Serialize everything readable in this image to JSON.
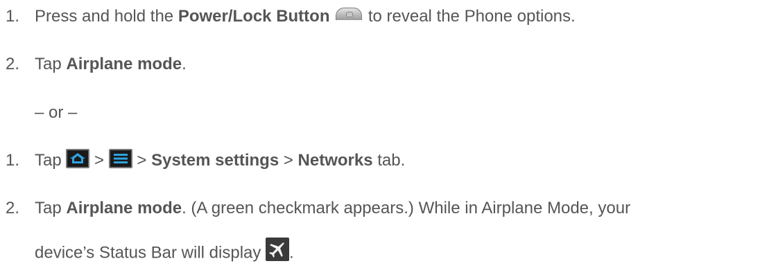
{
  "steps_a": [
    {
      "number": "1.",
      "pre": "Press and hold the ",
      "bold": "Power/Lock Button",
      "post": " to reveal the Phone options."
    },
    {
      "number": "2.",
      "pre": "Tap ",
      "bold": "Airplane mode",
      "post": "."
    }
  ],
  "separator": "– or –",
  "steps_b": [
    {
      "number": "1.",
      "tap": "Tap ",
      "sep1": " > ",
      "sep2": " > ",
      "bold1": "System settings",
      "sep3": " > ",
      "bold2": "Networks",
      "post": " tab."
    },
    {
      "number": "2.",
      "pre": "Tap ",
      "bold": "Airplane mode",
      "post": ". (A green checkmark appears.) While in Airplane Mode, your",
      "line2": "device’s Status Bar will display ",
      "line2_end": "."
    }
  ],
  "icons": {
    "power": "power-lock-button-icon",
    "home": "home-icon",
    "menu": "menu-icon",
    "airplane": "airplane-mode-status-icon"
  }
}
